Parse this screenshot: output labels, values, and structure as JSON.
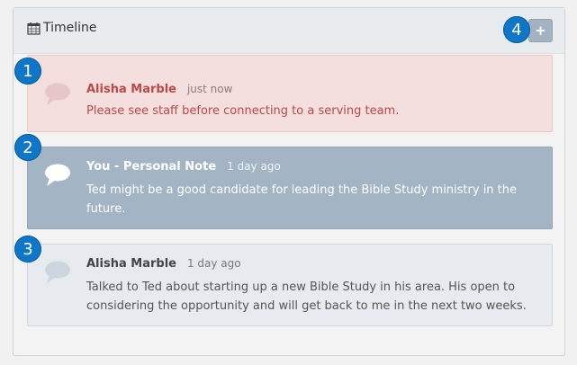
{
  "panel": {
    "title": "Timeline",
    "add_button": "+"
  },
  "badges": [
    "1",
    "2",
    "3",
    "4"
  ],
  "notes": [
    {
      "author": "Alisha Marble",
      "time": "just now",
      "text": "Please see staff before connecting to a serving team.",
      "style": "alert",
      "bubble_color": "#e7c6c6"
    },
    {
      "author": "You - Personal Note",
      "time": "1 day ago",
      "text": "Ted might be a good candidate for leading the Bible Study ministry in the future.",
      "style": "personal",
      "bubble_color": "#ffffff"
    },
    {
      "author": "Alisha Marble",
      "time": "1 day ago",
      "text": "Talked to Ted about starting up a new Bible Study in his area. His open to considering the opportunity and will get back to me in the next two weeks.",
      "style": "default",
      "bubble_color": "#cdd6df"
    }
  ],
  "colors": {
    "badge": "#0f76c8",
    "alert_text": "#b94a48",
    "personal_bg": "#a3b4c4"
  }
}
